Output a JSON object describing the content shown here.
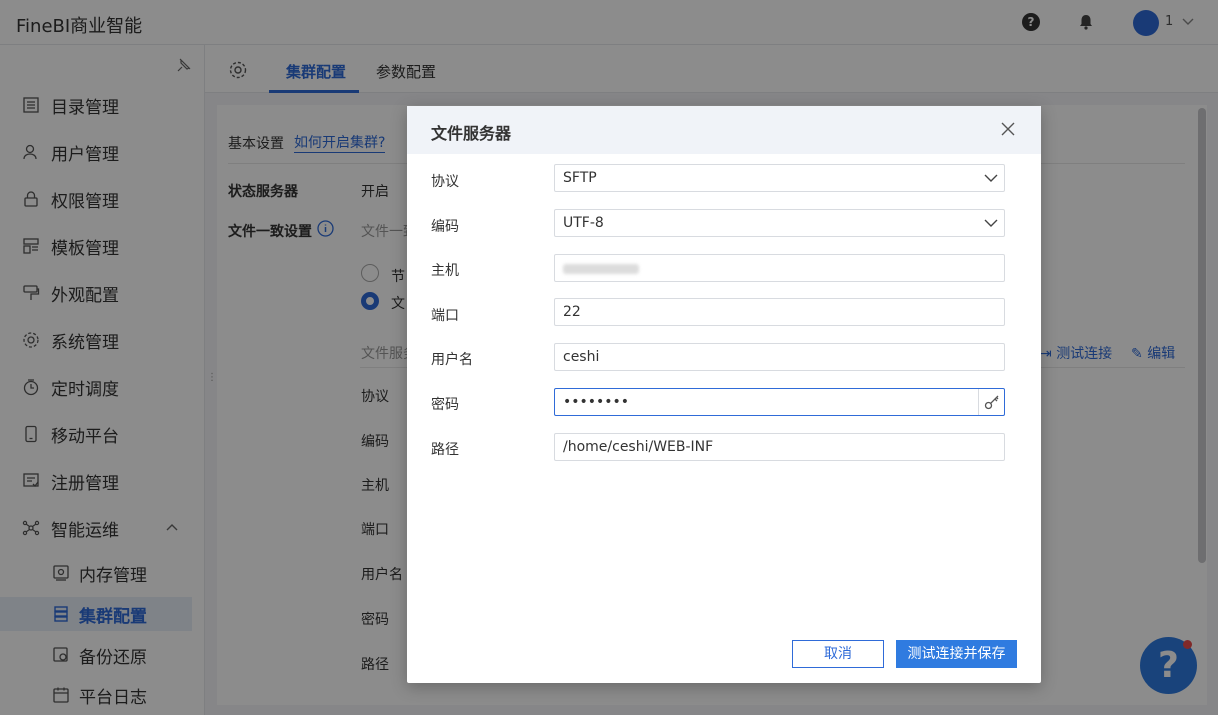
{
  "app": {
    "title": "FineBI商业智能",
    "user_number": "1"
  },
  "sidebar": {
    "items": [
      {
        "label": "目录管理",
        "icon": "list-icon"
      },
      {
        "label": "用户管理",
        "icon": "user-icon"
      },
      {
        "label": "权限管理",
        "icon": "lock-icon"
      },
      {
        "label": "模板管理",
        "icon": "template-icon"
      },
      {
        "label": "外观配置",
        "icon": "brush-icon"
      },
      {
        "label": "系统管理",
        "icon": "gear-icon"
      },
      {
        "label": "定时调度",
        "icon": "clock-icon"
      },
      {
        "label": "移动平台",
        "icon": "mobile-icon"
      },
      {
        "label": "注册管理",
        "icon": "register-icon"
      },
      {
        "label": "智能运维",
        "icon": "network-icon"
      }
    ],
    "sub_items": [
      {
        "label": "内存管理",
        "icon": "memory-icon"
      },
      {
        "label": "集群配置",
        "icon": "cluster-icon",
        "active": true
      },
      {
        "label": "备份还原",
        "icon": "backup-icon"
      },
      {
        "label": "平台日志",
        "icon": "log-icon"
      }
    ]
  },
  "tabs": {
    "cluster": "集群配置",
    "params": "参数配置"
  },
  "panel": {
    "basic_settings": "基本设置",
    "how_to_enable": "如何开启集群?",
    "state_server_label": "状态服务器",
    "state_server_value": "开启",
    "file_consistency_label": "文件一致设置",
    "file_consistency_hint": "文件一致",
    "radio_option_1": "节",
    "radio_option_2": "文",
    "file_server_sub": "文件服务",
    "test_connection": "测试连接",
    "edit": "编辑",
    "rows": [
      "协议",
      "编码",
      "主机",
      "端口",
      "用户名",
      "密码",
      "路径"
    ]
  },
  "dialog": {
    "title": "文件服务器",
    "fields": {
      "protocol": {
        "label": "协议",
        "value": "SFTP"
      },
      "encoding": {
        "label": "编码",
        "value": "UTF-8"
      },
      "host": {
        "label": "主机"
      },
      "port": {
        "label": "端口",
        "value": "22"
      },
      "username": {
        "label": "用户名",
        "value": "ceshi"
      },
      "password": {
        "label": "密码",
        "value": "••••••••"
      },
      "path": {
        "label": "路径",
        "value": "/home/ceshi/WEB-INF"
      }
    },
    "cancel": "取消",
    "test_and_save": "测试连接并保存"
  },
  "colors": {
    "accent": "#2f6bd8",
    "primary_button": "#2f7be0"
  }
}
